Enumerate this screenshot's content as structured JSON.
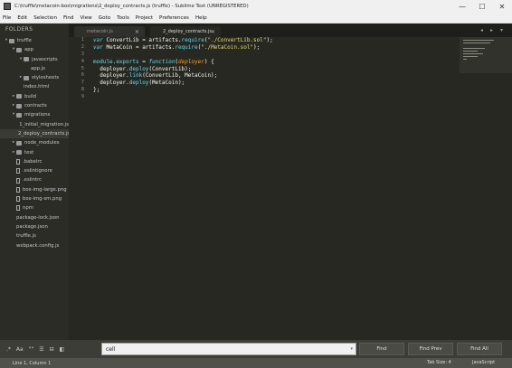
{
  "window": {
    "title": "C:\\truffle\\metacoin-box\\migrations\\2_deploy_contracts.js (truffle) - Sublime Text (UNREGISTERED)",
    "min_glyph": "—",
    "max_glyph": "☐",
    "close_glyph": "✕"
  },
  "menu": [
    "File",
    "Edit",
    "Selection",
    "Find",
    "View",
    "Goto",
    "Tools",
    "Project",
    "Preferences",
    "Help"
  ],
  "sidebar": {
    "header": "FOLDERS",
    "items": [
      {
        "label": "truffle",
        "arrow": "▾",
        "icon": "folder",
        "indent": 0
      },
      {
        "label": "app",
        "arrow": "▾",
        "icon": "folder",
        "indent": 1
      },
      {
        "label": "javascripts",
        "arrow": "▾",
        "icon": "folder",
        "indent": 2
      },
      {
        "label": "app.js",
        "arrow": "",
        "icon": "code",
        "indent": 3
      },
      {
        "label": "stylesheets",
        "arrow": "▸",
        "icon": "folder",
        "indent": 2
      },
      {
        "label": "index.html",
        "arrow": "",
        "icon": "code",
        "indent": 2
      },
      {
        "label": "build",
        "arrow": "▸",
        "icon": "folder",
        "indent": 1
      },
      {
        "label": "contracts",
        "arrow": "▸",
        "icon": "folder",
        "indent": 1
      },
      {
        "label": "migrations",
        "arrow": "▾",
        "icon": "folder",
        "indent": 1
      },
      {
        "label": "1_initial_migration.js",
        "arrow": "",
        "icon": "code",
        "indent": 2
      },
      {
        "label": "2_deploy_contracts.js",
        "arrow": "",
        "icon": "code",
        "indent": 2,
        "selected": true
      },
      {
        "label": "node_modules",
        "arrow": "▸",
        "icon": "folder",
        "indent": 1
      },
      {
        "label": "test",
        "arrow": "▸",
        "icon": "folder",
        "indent": 1
      },
      {
        "label": ".babelrc",
        "arrow": "",
        "icon": "file",
        "indent": 1
      },
      {
        "label": ".eslintignore",
        "arrow": "",
        "icon": "file",
        "indent": 1
      },
      {
        "label": ".eslintrc",
        "arrow": "",
        "icon": "file",
        "indent": 1
      },
      {
        "label": "box-img-large.png",
        "arrow": "",
        "icon": "file",
        "indent": 1
      },
      {
        "label": "box-img-sm.png",
        "arrow": "",
        "icon": "file",
        "indent": 1
      },
      {
        "label": "npm",
        "arrow": "",
        "icon": "file",
        "indent": 1
      },
      {
        "label": "package-lock.json",
        "arrow": "",
        "icon": "code",
        "indent": 1
      },
      {
        "label": "package.json",
        "arrow": "",
        "icon": "code",
        "indent": 1
      },
      {
        "label": "truffle.js",
        "arrow": "",
        "icon": "code",
        "indent": 1
      },
      {
        "label": "webpack.config.js",
        "arrow": "",
        "icon": "code",
        "indent": 1
      }
    ]
  },
  "tabs": [
    {
      "label": "metacoin.js",
      "close": "✕",
      "active": false
    },
    {
      "label": "2_deploy_contracts.js",
      "close": "✕",
      "active": true
    }
  ],
  "tab_controls": {
    "left": "◂",
    "right": "▸",
    "menu": "▾"
  },
  "editor": {
    "line_numbers": [
      "1",
      "2",
      "3",
      "4",
      "5",
      "6",
      "7",
      "8",
      "9"
    ],
    "lines": [
      [
        {
          "t": "var",
          "c": "kw"
        },
        {
          "t": " ConvertLib = artifacts.",
          "c": "ws"
        },
        {
          "t": "require",
          "c": "fn"
        },
        {
          "t": "(",
          "c": "punct"
        },
        {
          "t": "\"./ConvertLib.sol\"",
          "c": "str"
        },
        {
          "t": ");",
          "c": "punct"
        }
      ],
      [
        {
          "t": "var",
          "c": "kw"
        },
        {
          "t": " MetaCoin = artifacts.",
          "c": "ws"
        },
        {
          "t": "require",
          "c": "fn"
        },
        {
          "t": "(",
          "c": "punct"
        },
        {
          "t": "\"./MetaCoin.sol\"",
          "c": "str"
        },
        {
          "t": ");",
          "c": "punct"
        }
      ],
      [],
      [
        {
          "t": "module",
          "c": "fn"
        },
        {
          "t": ".",
          "c": "ws"
        },
        {
          "t": "exports",
          "c": "fn"
        },
        {
          "t": " = ",
          "c": "ws"
        },
        {
          "t": "function",
          "c": "kw"
        },
        {
          "t": "(",
          "c": "punct"
        },
        {
          "t": "deployer",
          "c": "arg"
        },
        {
          "t": ") {",
          "c": "punct"
        }
      ],
      [
        {
          "t": "  deployer.",
          "c": "ws"
        },
        {
          "t": "deploy",
          "c": "fn"
        },
        {
          "t": "(ConvertLib);",
          "c": "ws"
        }
      ],
      [
        {
          "t": "  deployer.",
          "c": "ws"
        },
        {
          "t": "link",
          "c": "fn"
        },
        {
          "t": "(ConvertLib, MetaCoin);",
          "c": "ws"
        }
      ],
      [
        {
          "t": "  deployer.",
          "c": "ws"
        },
        {
          "t": "deploy",
          "c": "fn"
        },
        {
          "t": "(MetaCoin);",
          "c": "ws"
        }
      ],
      [
        {
          "t": "};",
          "c": "ws"
        }
      ],
      []
    ]
  },
  "findbar": {
    "options": [
      ".*",
      "Aa",
      "\"\"",
      "☰",
      "⊟",
      "◧"
    ],
    "value": "cell",
    "dropdown_glyph": "▾",
    "find": "Find",
    "find_prev": "Find Prev",
    "find_all": "Find All"
  },
  "status": {
    "position": "Line 1, Column 1",
    "tab_size": "Tab Size: 4",
    "syntax": "JavaScript"
  },
  "colors": {
    "editor_bg": "#272822",
    "sidebar_bg": "#2b2c26",
    "keyword": "#66d9ef",
    "string": "#e6db74",
    "argument": "#fd971f"
  }
}
